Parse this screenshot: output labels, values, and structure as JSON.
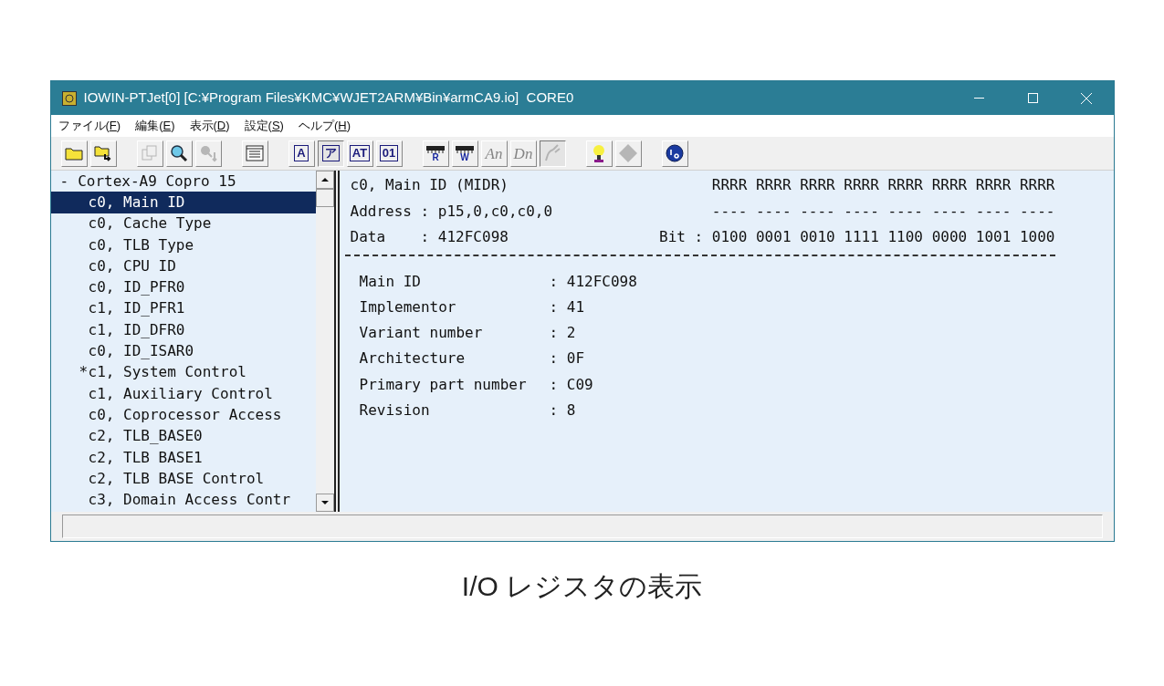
{
  "window": {
    "title": "IOWIN-PTJet[0] [C:¥Program Files¥KMC¥WJET2ARM¥Bin¥armCA9.io]  CORE0"
  },
  "menu": [
    {
      "text": "ファイル(",
      "key": "F",
      "suffix": ")"
    },
    {
      "text": "編集(",
      "key": "E",
      "suffix": ")"
    },
    {
      "text": "表示(",
      "key": "D",
      "suffix": ")"
    },
    {
      "text": "設定(",
      "key": "S",
      "suffix": ")"
    },
    {
      "text": "ヘルプ(",
      "key": "H",
      "suffix": ")"
    }
  ],
  "toolbar": {
    "groups": [
      [
        {
          "kind": "folder",
          "disabled": false,
          "pressed": false
        },
        {
          "kind": "folder-arrow",
          "disabled": false,
          "pressed": false
        }
      ],
      [
        {
          "kind": "copy",
          "disabled": true,
          "pressed": false
        },
        {
          "kind": "search",
          "disabled": false,
          "pressed": false
        },
        {
          "kind": "search-next",
          "disabled": true,
          "pressed": false
        }
      ],
      [
        {
          "kind": "list",
          "disabled": false,
          "pressed": false
        }
      ],
      [
        {
          "kind": "letter",
          "label": "A",
          "disabled": false,
          "pressed": false
        },
        {
          "kind": "letter",
          "label": "ア",
          "disabled": false,
          "pressed": true
        },
        {
          "kind": "letter",
          "label": "AT",
          "disabled": false,
          "pressed": false
        },
        {
          "kind": "letter",
          "label": "01",
          "disabled": false,
          "pressed": false
        }
      ],
      [
        {
          "kind": "chip",
          "label": "R",
          "disabled": false,
          "pressed": false
        },
        {
          "kind": "chip",
          "label": "W",
          "disabled": false,
          "pressed": false
        },
        {
          "kind": "serif",
          "label": "An",
          "disabled": true,
          "pressed": false
        },
        {
          "kind": "serif",
          "label": "Dn",
          "disabled": true,
          "pressed": false
        },
        {
          "kind": "plug",
          "disabled": true,
          "pressed": true
        }
      ],
      [
        {
          "kind": "bulb",
          "disabled": false,
          "pressed": false
        },
        {
          "kind": "diamond",
          "disabled": true,
          "pressed": false
        }
      ],
      [
        {
          "kind": "info",
          "disabled": false,
          "pressed": false
        }
      ]
    ]
  },
  "tree": {
    "toggle": "-",
    "label": "Cortex-A9 Copro 15",
    "children": [
      {
        "label": "c0, Main ID",
        "selected": true
      },
      {
        "label": "c0, Cache Type",
        "selected": false
      },
      {
        "label": "c0, TLB Type",
        "selected": false
      },
      {
        "label": "c0, CPU ID",
        "selected": false
      },
      {
        "label": "c0, ID_PFR0",
        "selected": false
      },
      {
        "label": "c1, ID_PFR1",
        "selected": false
      },
      {
        "label": "c1, ID_DFR0",
        "selected": false
      },
      {
        "label": "c0, ID_ISAR0",
        "selected": false
      },
      {
        "mark": "*",
        "label": "c1, System Control",
        "selected": false
      },
      {
        "label": "c1, Auxiliary Control",
        "selected": false
      },
      {
        "label": "c0, Coprocessor Access",
        "selected": false
      },
      {
        "label": "c2, TLB_BASE0",
        "selected": false
      },
      {
        "label": "c2, TLB BASE1",
        "selected": false
      },
      {
        "label": "c2, TLB BASE Control",
        "selected": false
      },
      {
        "label": "c3, Domain Access Contr",
        "selected": false
      }
    ]
  },
  "register": {
    "header": [
      {
        "left": "c0, Main ID (MIDR)",
        "right": "RRRR RRRR RRRR RRRR RRRR RRRR RRRR RRRR"
      },
      {
        "left": "Address : p15,0,c0,c0,0",
        "right": "---- ---- ---- ---- ---- ---- ---- ----"
      },
      {
        "left": "Data    : 412FC098",
        "right": "Bit : 0100 0001 0010 1111 1100 0000 1001 1000"
      }
    ],
    "fields": [
      {
        "name": "Main ID",
        "value": ": 412FC098"
      },
      {
        "name": "Implementor",
        "value": ": 41"
      },
      {
        "name": "Variant number",
        "value": ": 2"
      },
      {
        "name": "Architecture",
        "value": ": 0F"
      },
      {
        "name": "Primary part number",
        "value": ": C09"
      },
      {
        "name": "Revision",
        "value": ": 8"
      }
    ]
  },
  "caption": "I/O レジスタの表示"
}
